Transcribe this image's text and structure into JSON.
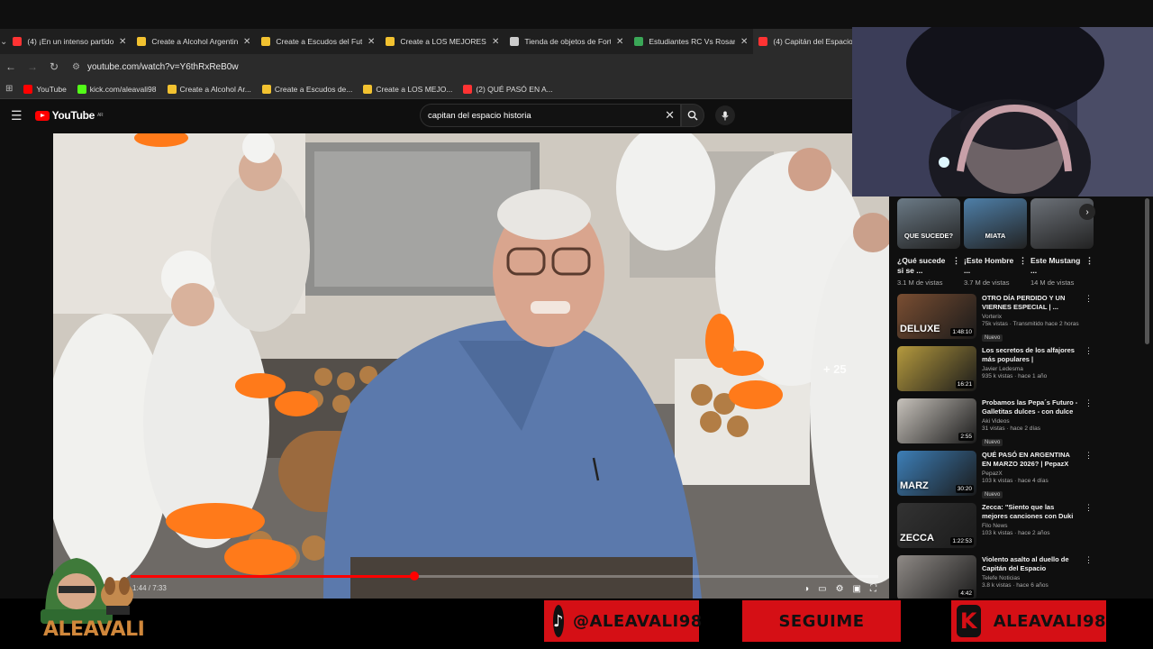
{
  "browser": {
    "tabs": [
      {
        "title": "(4) ¡En un intenso partido",
        "color": "#ff3333"
      },
      {
        "title": "Create a Alcohol Argentin",
        "color": "#f2c230"
      },
      {
        "title": "Create a Escudos del Futb",
        "color": "#f2c230"
      },
      {
        "title": "Create a LOS MEJORES AR",
        "color": "#f2c230"
      },
      {
        "title": "Tienda de objetos de Fort",
        "color": "#cccccc"
      },
      {
        "title": "Estudiantes RC Vs Rosario",
        "color": "#3aa757"
      },
      {
        "title": "(4) Capitán del Espacio",
        "color": "#ff3333"
      }
    ],
    "url": "youtube.com/watch?v=Y6thRxReB0w",
    "bookmarks": [
      {
        "label": "YouTube",
        "color": "#ff0000"
      },
      {
        "label": "kick.com/aleavali98",
        "color": "#53fc18"
      },
      {
        "label": "Create a Alcohol Ar...",
        "color": "#f2c230"
      },
      {
        "label": "Create a Escudos de...",
        "color": "#f2c230"
      },
      {
        "label": "Create a LOS MEJO...",
        "color": "#f2c230"
      },
      {
        "label": "(2) QUÉ PASÓ EN A...",
        "color": "#ff3333"
      }
    ]
  },
  "youtube": {
    "logo": "YouTube",
    "region": "AR",
    "search_value": "capitan del espacio historia"
  },
  "video": {
    "time": "1:44 / 7:33",
    "progress": 0.38,
    "end_screen_count": "+ 25"
  },
  "shorts": [
    {
      "title": "¿Qué sucede si se ...",
      "views": "3.1 M de vistas",
      "caption": "QUE SUCEDE?",
      "color": "#6b7a86"
    },
    {
      "title": "¡Este Hombre ...",
      "views": "3.7 M de vistas",
      "caption": "MIATA",
      "color": "#4e7fa8"
    },
    {
      "title": "Este Mustang ...",
      "views": "14 M de vistas",
      "caption": "",
      "color": "#6c7178"
    }
  ],
  "recommendations": [
    {
      "title": "OTRO DÍA PERDIDO Y UN VIERNES ESPECIAL | ...",
      "channel": "Vorterix",
      "meta": "75k vistas · Transmitido hace 2 horas",
      "badge": "Nuevo",
      "duration": "1:48:10",
      "overlay": "DELUXE",
      "color": "#7a4e32"
    },
    {
      "title": "Los secretos de los alfajores más populares | #BIZELANEA...",
      "channel": "Javier Ledesma",
      "meta": "935 k vistas · hace 1 año",
      "badge": "",
      "duration": "16:21",
      "overlay": "",
      "color": "#b59a3e"
    },
    {
      "title": "Probamos las Pepa´s Futuro - Galletitas dulces - con dulce d...",
      "channel": "Aki Videos",
      "meta": "31 vistas · hace 2 días",
      "badge": "Nuevo",
      "duration": "2:55",
      "overlay": "",
      "color": "#c7c2bb"
    },
    {
      "title": "QUÉ PASÓ EN ARGENTINA EN MARZO 2026? | PepazX",
      "channel": "PepazX",
      "meta": "103 k vistas · hace 4 días",
      "badge": "Nuevo",
      "duration": "30:20",
      "overlay": "MARZ",
      "color": "#3d7fb8"
    },
    {
      "title": "Zecca: \"Siento que las mejores canciones con Duki todavía no...",
      "channel": "Filo News",
      "meta": "103 k vistas · hace 2 años",
      "badge": "",
      "duration": "1:22:53",
      "overlay": "ZECCA",
      "color": "#333333"
    },
    {
      "title": "Violento asalto al duello de Capitán del Espacio",
      "channel": "Telefe Noticias",
      "meta": "3.8 k vistas · hace 6 años",
      "badge": "",
      "duration": "4:42",
      "overlay": "",
      "color": "#8f8a86"
    }
  ],
  "stream": {
    "streamer": "ALEAVALI",
    "tiktok": "@ALEAVALI98",
    "cta": "SEGUIME",
    "kick": "ALEAVALI98"
  },
  "colors": {
    "youtube_red": "#ff0000",
    "panel_red": "#d50f15",
    "mascot_orange": "#d0873b"
  }
}
